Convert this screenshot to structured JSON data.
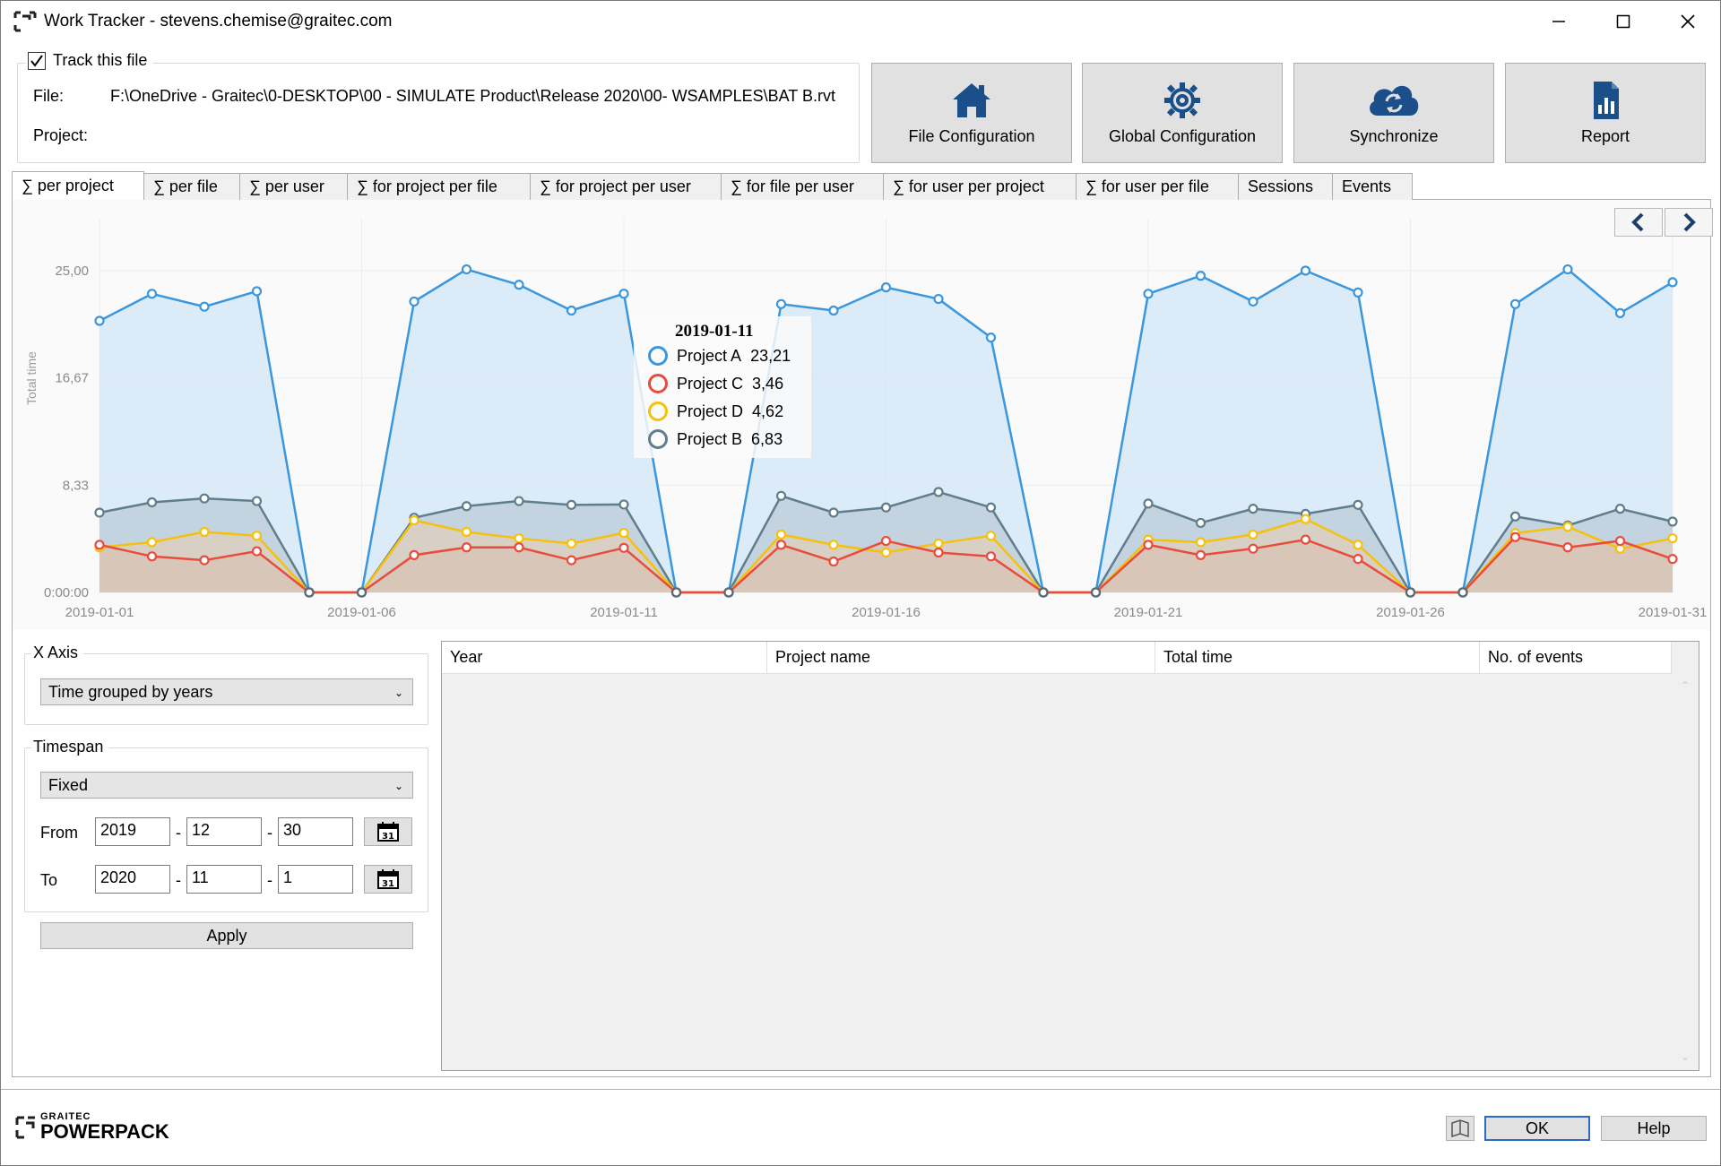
{
  "window": {
    "title": "Work Tracker - stevens.chemise@graitec.com"
  },
  "track": {
    "checkbox_label": "Track this file",
    "checked": true,
    "file_label": "File:",
    "file_path": "F:\\OneDrive - Graitec\\0-DESKTOP\\00 - SIMULATE Product\\Release 2020\\00- WSAMPLES\\BAT B.rvt",
    "project_label": "Project:",
    "project_value": ""
  },
  "toolbar": {
    "file_config": "File Configuration",
    "global_config": "Global Configuration",
    "synchronize": "Synchronize",
    "report": "Report"
  },
  "tabs": [
    {
      "label": "∑ per project",
      "active": true
    },
    {
      "label": "∑ per file"
    },
    {
      "label": "∑ per user"
    },
    {
      "label": "∑ for project per file"
    },
    {
      "label": "∑ for project per user"
    },
    {
      "label": "∑ for file per user"
    },
    {
      "label": "∑ for user per project"
    },
    {
      "label": "∑ for user per file"
    },
    {
      "label": "Sessions"
    },
    {
      "label": "Events"
    }
  ],
  "tooltip": {
    "date": "2019-01-11",
    "rows": [
      {
        "name": "Project A",
        "value": "23,21",
        "color": "#3a96dd"
      },
      {
        "name": "Project C",
        "value": "3,46",
        "color": "#e84c3d"
      },
      {
        "name": "Project D",
        "value": "4,62",
        "color": "#f4c20d"
      },
      {
        "name": "Project B",
        "value": "6,83",
        "color": "#607d8b"
      }
    ]
  },
  "chart_data": {
    "type": "area",
    "ylabel": "Total time",
    "ytick_labels": [
      "0:00:00",
      "8,33",
      "16,67",
      "25,00"
    ],
    "yticks": [
      0,
      8.33,
      16.67,
      25.0
    ],
    "ylim": [
      0,
      30.5
    ],
    "xtick_labels": [
      "2019-01-01",
      "2019-01-06",
      "2019-01-11",
      "2019-01-16",
      "2019-01-21",
      "2019-01-26",
      "2019-01-31"
    ],
    "x": [
      "2019-01-01",
      "2019-01-02",
      "2019-01-03",
      "2019-01-04",
      "2019-01-05",
      "2019-01-06",
      "2019-01-07",
      "2019-01-08",
      "2019-01-09",
      "2019-01-10",
      "2019-01-11",
      "2019-01-12",
      "2019-01-13",
      "2019-01-14",
      "2019-01-15",
      "2019-01-16",
      "2019-01-17",
      "2019-01-18",
      "2019-01-19",
      "2019-01-20",
      "2019-01-21",
      "2019-01-22",
      "2019-01-23",
      "2019-01-24",
      "2019-01-25",
      "2019-01-26",
      "2019-01-27",
      "2019-01-28",
      "2019-01-29",
      "2019-01-30",
      "2019-01-31"
    ],
    "grid": true,
    "series": [
      {
        "name": "Project A",
        "color": "#3a96dd",
        "fill": "#d6e8f7",
        "values": [
          21.1,
          23.2,
          22.2,
          23.4,
          0,
          0,
          22.6,
          25.1,
          23.9,
          21.9,
          23.21,
          0,
          0,
          22.4,
          21.9,
          23.7,
          22.8,
          19.8,
          0,
          0,
          23.2,
          24.6,
          22.6,
          25.0,
          23.3,
          0,
          0,
          22.4,
          25.1,
          21.7,
          24.1
        ]
      },
      {
        "name": "Project B",
        "color": "#607d8b",
        "fill": "#bfcfdc",
        "values": [
          6.2,
          7.0,
          7.3,
          7.1,
          0,
          0,
          5.8,
          6.7,
          7.1,
          6.8,
          6.83,
          0,
          0,
          7.5,
          6.2,
          6.6,
          7.8,
          6.6,
          0,
          0,
          6.9,
          5.4,
          6.5,
          6.1,
          6.8,
          0,
          0,
          5.9,
          5.2,
          6.5,
          5.5
        ]
      },
      {
        "name": "Project D",
        "color": "#f4c20d",
        "fill": "#dccfbe",
        "values": [
          3.5,
          3.9,
          4.7,
          4.4,
          0,
          0,
          5.6,
          4.7,
          4.2,
          3.8,
          4.62,
          0,
          0,
          4.5,
          3.7,
          3.1,
          3.8,
          4.4,
          0,
          0,
          4.1,
          3.9,
          4.5,
          5.7,
          3.7,
          0,
          0,
          4.6,
          5.1,
          3.4,
          4.2
        ]
      },
      {
        "name": "Project C",
        "color": "#e84c3d",
        "fill": "#d8c4b6",
        "values": [
          3.7,
          2.8,
          2.5,
          3.2,
          0,
          0,
          2.9,
          3.5,
          3.5,
          2.5,
          3.46,
          0,
          0,
          3.7,
          2.4,
          4.0,
          3.1,
          2.8,
          0,
          0,
          3.7,
          2.9,
          3.4,
          4.1,
          2.6,
          0,
          0,
          4.3,
          3.5,
          4.0,
          2.6
        ]
      }
    ]
  },
  "xaxis_group": {
    "legend": "X Axis",
    "selected": "Time grouped by years"
  },
  "timespan_group": {
    "legend": "Timespan",
    "selected": "Fixed",
    "from_label": "From",
    "to_label": "To",
    "from": {
      "year": "2019",
      "month": "12",
      "day": "30"
    },
    "to": {
      "year": "2020",
      "month": "11",
      "day": "1"
    },
    "separator": "-"
  },
  "apply_label": "Apply",
  "grid": {
    "columns": [
      "Year",
      "Project name",
      "Total time",
      "No. of events"
    ]
  },
  "footer": {
    "logo_small": "GRAITEC",
    "logo_big": "POWERPACK",
    "ok": "OK",
    "help": "Help"
  }
}
